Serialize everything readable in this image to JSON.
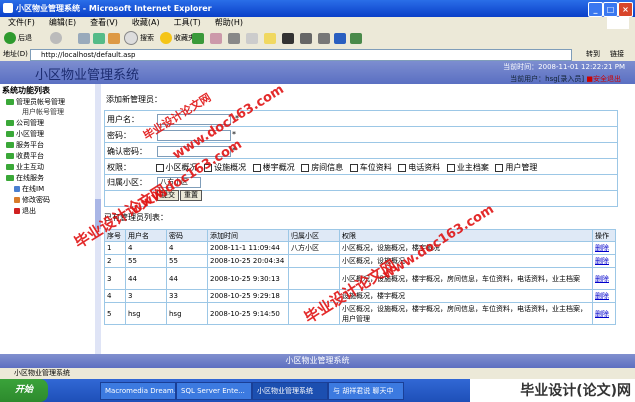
{
  "window": {
    "title": "小区物业管理系统 - Microsoft Internet Explorer"
  },
  "menu": [
    "文件(F)",
    "编辑(E)",
    "查看(V)",
    "收藏(A)",
    "工具(T)",
    "帮助(H)"
  ],
  "toolbar": {
    "back": "后退",
    "search": "搜索",
    "favorites": "收藏夹"
  },
  "address": {
    "label": "地址(D)",
    "url": "http://localhost/default.asp",
    "go": "转到",
    "links": "链接"
  },
  "header": {
    "system_name": "小区物业管理系统",
    "time": "当前时间：2008-11-01 12:22:21 PM",
    "user": "当前用户：hsg[录入员]",
    "logout": "安全退出"
  },
  "sidebar": {
    "title": "系统功能列表",
    "items": [
      "管理员帐号管理",
      "用户帐号管理",
      "公司管理",
      "小区管理",
      "服务平台",
      "收费平台",
      "业主互动",
      "在线服务",
      "在线IM",
      "修改密码",
      "退出"
    ]
  },
  "form": {
    "title": "添加新管理员：",
    "username_label": "用户名：",
    "password_label": "密码：",
    "confirm_label": "确认密码：",
    "required_mark": "*",
    "perm_label": "权限：",
    "perms": [
      "小区概况",
      "设施概况",
      "楼宇概况",
      "房间信息",
      "车位资料",
      "电话资料",
      "业主档案",
      "用户管理"
    ],
    "estate_label": "归属小区：",
    "estate_value": "八方小区",
    "submit": "提交",
    "reset": "重置"
  },
  "list": {
    "title": "已有管理员列表：",
    "headers": [
      "序号",
      "用户名",
      "密码",
      "添加时间",
      "归属小区",
      "权限",
      "操作"
    ],
    "rows": [
      [
        "1",
        "4",
        "4",
        "2008-11-1 11:09:44",
        "八方小区",
        "小区概况，设施概况，楼宇概况",
        "删除"
      ],
      [
        "2",
        "55",
        "55",
        "2008-10-25 20:04:34",
        "",
        "小区概况，设施概况",
        "删除"
      ],
      [
        "3",
        "44",
        "44",
        "2008-10-25 9:30:13",
        "",
        "小区概况，设施概况，楼宇概况，房间信息，车位资料，电话资料，业主档案",
        "删除"
      ],
      [
        "4",
        "3",
        "33",
        "2008-10-25 9:29:18",
        "",
        "设施概况，楼宇概况",
        "删除"
      ],
      [
        "5",
        "hsg",
        "hsg",
        "2008-10-25 9:14:50",
        "",
        "小区概况，设施概况，楼宇概况，房间信息，车位资料，电话资料，业主档案，用户管理",
        "删除"
      ]
    ]
  },
  "footer": {
    "text": "小区物业管理系统"
  },
  "status": {
    "text": "小区物业管理系统"
  },
  "taskbar": {
    "start": "开始",
    "tasks": [
      "Macromedia Dream...",
      "SQL Server Ente...",
      "小区物业管理系统",
      "与 胡祥君说 聊天中"
    ],
    "brand": "毕业设计(论文)网"
  },
  "watermarks": [
    "毕业设计论文网",
    "www.doc163.com",
    "毕业设计论文网",
    "www.doc163.com",
    "毕业设计论文网",
    "www.doc163.com"
  ]
}
